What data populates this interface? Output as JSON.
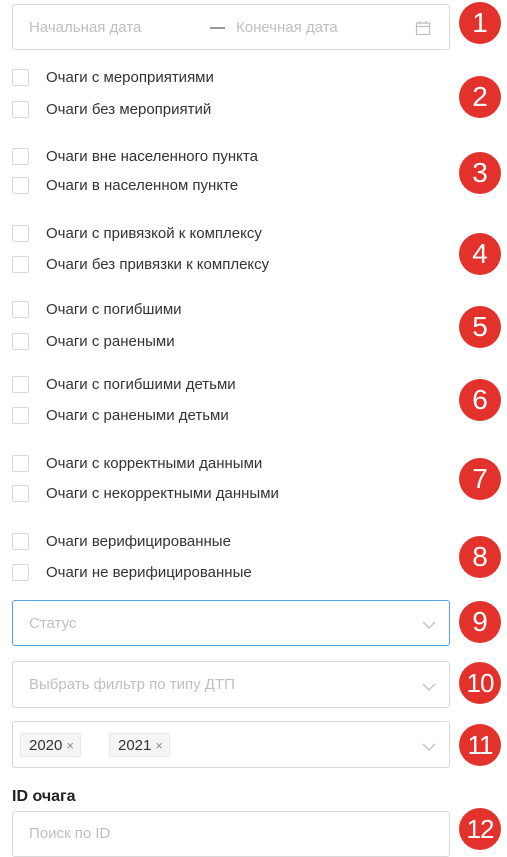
{
  "date_range": {
    "start_placeholder": "Начальная дата",
    "separator": "—",
    "end_placeholder": "Конечная дата",
    "icon": "calendar-icon"
  },
  "checkbox_groups": [
    {
      "badge": "1",
      "items": []
    },
    {
      "badge": "2",
      "items": [
        "Очаги с мероприятиями",
        "Очаги без мероприятий"
      ]
    },
    {
      "badge": "3",
      "items": [
        "Очаги вне населенного пункта",
        "Очаги в населенном пункте"
      ]
    },
    {
      "badge": "4",
      "items": [
        "Очаги с привязкой к комплексу",
        "Очаги без привязки к комплексу"
      ]
    },
    {
      "badge": "5",
      "items": [
        "Очаги с погибшими",
        "Очаги с ранеными"
      ]
    },
    {
      "badge": "6",
      "items": [
        "Очаги с погибшими детьми",
        "Очаги с ранеными детьми"
      ]
    },
    {
      "badge": "7",
      "items": [
        "Очаги с корректными данными",
        "Очаги с некорректными данными"
      ]
    },
    {
      "badge": "8",
      "items": [
        "Очаги верифицированные",
        "Очаги не верифицированные"
      ]
    }
  ],
  "status_select": {
    "placeholder": "Статус",
    "badge": "9"
  },
  "dtp_type_select": {
    "placeholder": "Выбрать фильтр по типу ДТП",
    "badge": "10"
  },
  "year_select": {
    "tags": [
      "2020",
      "2021"
    ],
    "remove_glyph": "×",
    "badge": "11"
  },
  "id_search": {
    "label": "ID очага",
    "placeholder": "Поиск по ID",
    "badge": "12"
  },
  "colors": {
    "badge": "#e2322b",
    "border": "#d9d9d9",
    "focus_border": "#4fa3e6",
    "placeholder": "#bfbfbf"
  }
}
